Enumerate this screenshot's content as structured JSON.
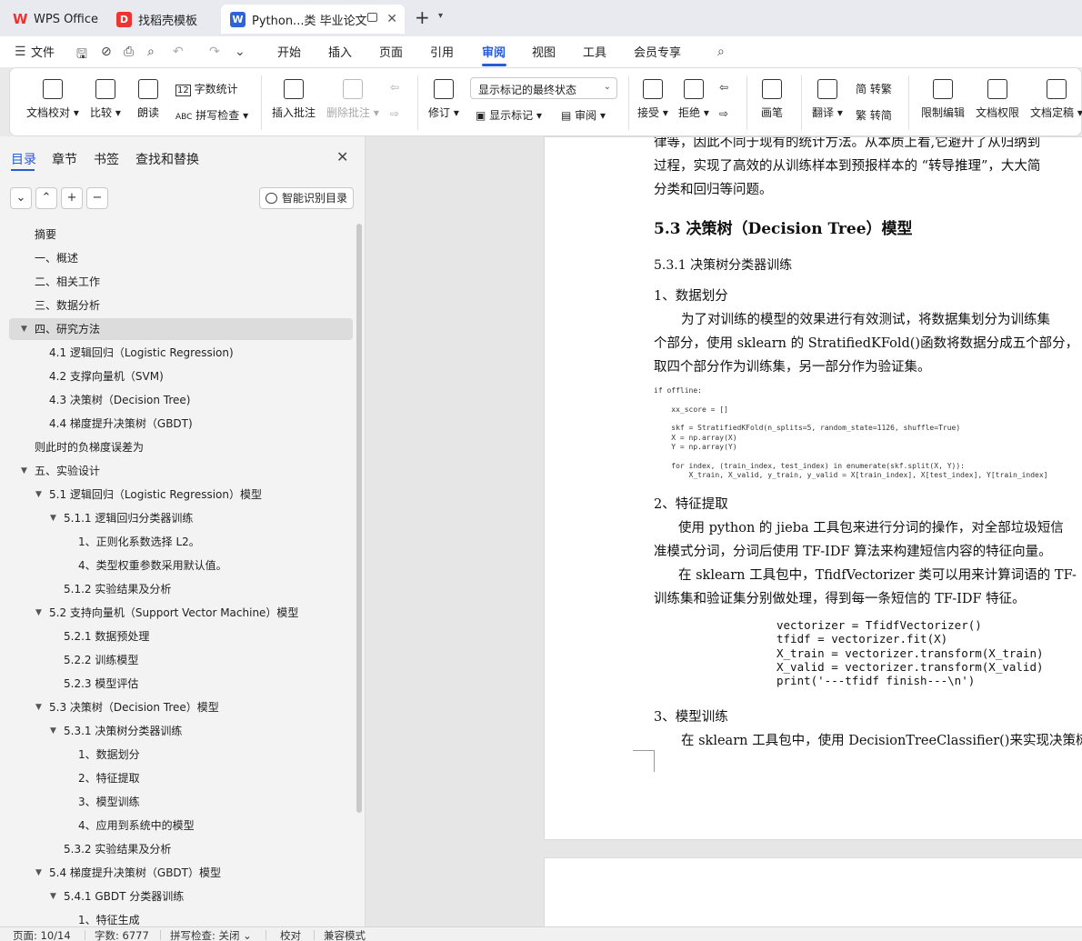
{
  "tabs": [
    {
      "label": "WPS Office"
    },
    {
      "label": "找稻壳模板"
    },
    {
      "label": "Python...类 毕业论文"
    }
  ],
  "menu": {
    "file": "文件",
    "items": [
      "开始",
      "插入",
      "页面",
      "引用",
      "审阅",
      "视图",
      "工具",
      "会员专享"
    ],
    "active": "审阅"
  },
  "ribbon": {
    "doc_check": "文档校对",
    "compare": "比较",
    "read_aloud": "朗读",
    "word_count": "字数统计",
    "spell_check": "拼写检查",
    "insert_comment": "插入批注",
    "delete_comment": "删除批注",
    "revise": "修订",
    "markup_state": "显示标记的最终状态",
    "show_markup": "显示标记",
    "review_pane": "审阅",
    "accept": "接受",
    "reject": "拒绝",
    "ink": "画笔",
    "translate": "翻译",
    "to_traditional": "转繁",
    "to_simplified": "转简",
    "restrict_edit": "限制编辑",
    "doc_permission": "文档权限",
    "doc_finalize": "文档定稿"
  },
  "panel": {
    "tabs": [
      "目录",
      "章节",
      "书签",
      "查找和替换"
    ],
    "smart_toc": "智能识别目录",
    "toc": [
      {
        "label": "摘要",
        "level": 0
      },
      {
        "label": "一、概述",
        "level": 0
      },
      {
        "label": "二、相关工作",
        "level": 0
      },
      {
        "label": "三、数据分析",
        "level": 0
      },
      {
        "label": "四、研究方法",
        "level": 0,
        "expanded": true,
        "selected": true
      },
      {
        "label": "4.1 逻辑回归（Logistic Regression)",
        "level": 1
      },
      {
        "label": "4.2 支撑向量机（SVM)",
        "level": 1
      },
      {
        "label": "4.3 决策树（Decision Tree)",
        "level": 1
      },
      {
        "label": "4.4 梯度提升决策树（GBDT)",
        "level": 1
      },
      {
        "label": "则此时的负梯度误差为",
        "level": 0
      },
      {
        "label": "五、实验设计",
        "level": 0,
        "expanded": true
      },
      {
        "label": "5.1 逻辑回归（Logistic Regression）模型",
        "level": 1,
        "expanded": true
      },
      {
        "label": "5.1.1 逻辑回归分类器训练",
        "level": 2,
        "expanded": true
      },
      {
        "label": "1、正则化系数选择 L2。",
        "level": 3
      },
      {
        "label": "4、类型权重参数采用默认值。",
        "level": 3
      },
      {
        "label": "5.1.2 实验结果及分析",
        "level": 2
      },
      {
        "label": "5.2 支持向量机（Support Vector Machine）模型",
        "level": 1,
        "expanded": true
      },
      {
        "label": "5.2.1 数据预处理",
        "level": 2
      },
      {
        "label": "5.2.2 训练模型",
        "level": 2
      },
      {
        "label": "5.2.3 模型评估",
        "level": 2
      },
      {
        "label": "5.3 决策树（Decision Tree）模型",
        "level": 1,
        "expanded": true
      },
      {
        "label": "5.3.1 决策树分类器训练",
        "level": 2,
        "expanded": true
      },
      {
        "label": "1、数据划分",
        "level": 3
      },
      {
        "label": "2、特征提取",
        "level": 3
      },
      {
        "label": "3、模型训练",
        "level": 3
      },
      {
        "label": "4、应用到系统中的模型",
        "level": 3
      },
      {
        "label": "5.3.2 实验结果及分析",
        "level": 2
      },
      {
        "label": "5.4 梯度提升决策树（GBDT）模型",
        "level": 1,
        "expanded": true
      },
      {
        "label": "5.4.1 GBDT 分类器训练",
        "level": 2,
        "expanded": true
      },
      {
        "label": "1、特征生成",
        "level": 3
      }
    ]
  },
  "doc": {
    "lines": [
      "律等，因此不同于现有的统计方法。从本质上看,它避开了从归纳到",
      "过程，实现了高效的从训练样本到预报样本的 “转导推理”，大大简",
      "分类和回归等问题。"
    ],
    "h2": "5.3  决策树（Decision Tree）模型",
    "h3": "5.3.1  决策树分类器训练",
    "sec1": "1、数据划分",
    "p1": [
      "为了对训练的模型的效果进行有效测试，将数据集划分为训练集",
      "个部分，使用 sklearn 的 StratifiedKFold()函数将数据分成五个部分，",
      "取四个部分作为训练集，另一部分作为验证集。"
    ],
    "code1": [
      "if offline:",
      "    xx_score = []",
      "    skf = StratifiedKFold(n_splits=5, random_state=1126, shuffle=True)",
      "    X = np.array(X)",
      "    Y = np.array(Y)",
      "    for index, (train_index, test_index) in enumerate(skf.split(X, Y)):",
      "        X_train, X_valid, y_train, y_valid = X[train_index], X[test_index], Y[train_index]"
    ],
    "sec2": "2、特征提取",
    "p2": [
      "使用 python 的 jieba 工具包来进行分词的操作，对全部垃圾短信",
      "准模式分词，分词后使用 TF-IDF 算法来构建短信内容的特征向量。",
      "在 sklearn 工具包中，TfidfVectorizer 类可以用来计算词语的 TF-",
      "训练集和验证集分别做处理，得到每一条短信的 TF-IDF 特征。"
    ],
    "code2": [
      "vectorizer = TfidfVectorizer()",
      "tfidf = vectorizer.fit(X)",
      "X_train = vectorizer.transform(X_train)",
      "X_valid = vectorizer.transform(X_valid)",
      "print('---tfidf finish---\\n')"
    ],
    "sec3": "3、模型训练",
    "p3": "在 sklearn 工具包中，使用 DecisionTreeClassifier()来实现决策树"
  },
  "status": {
    "page": "页面: 10/14",
    "words": "字数: 6777",
    "spell": "拼写检查: 关闭",
    "proof": "校对",
    "compat": "兼容模式"
  }
}
